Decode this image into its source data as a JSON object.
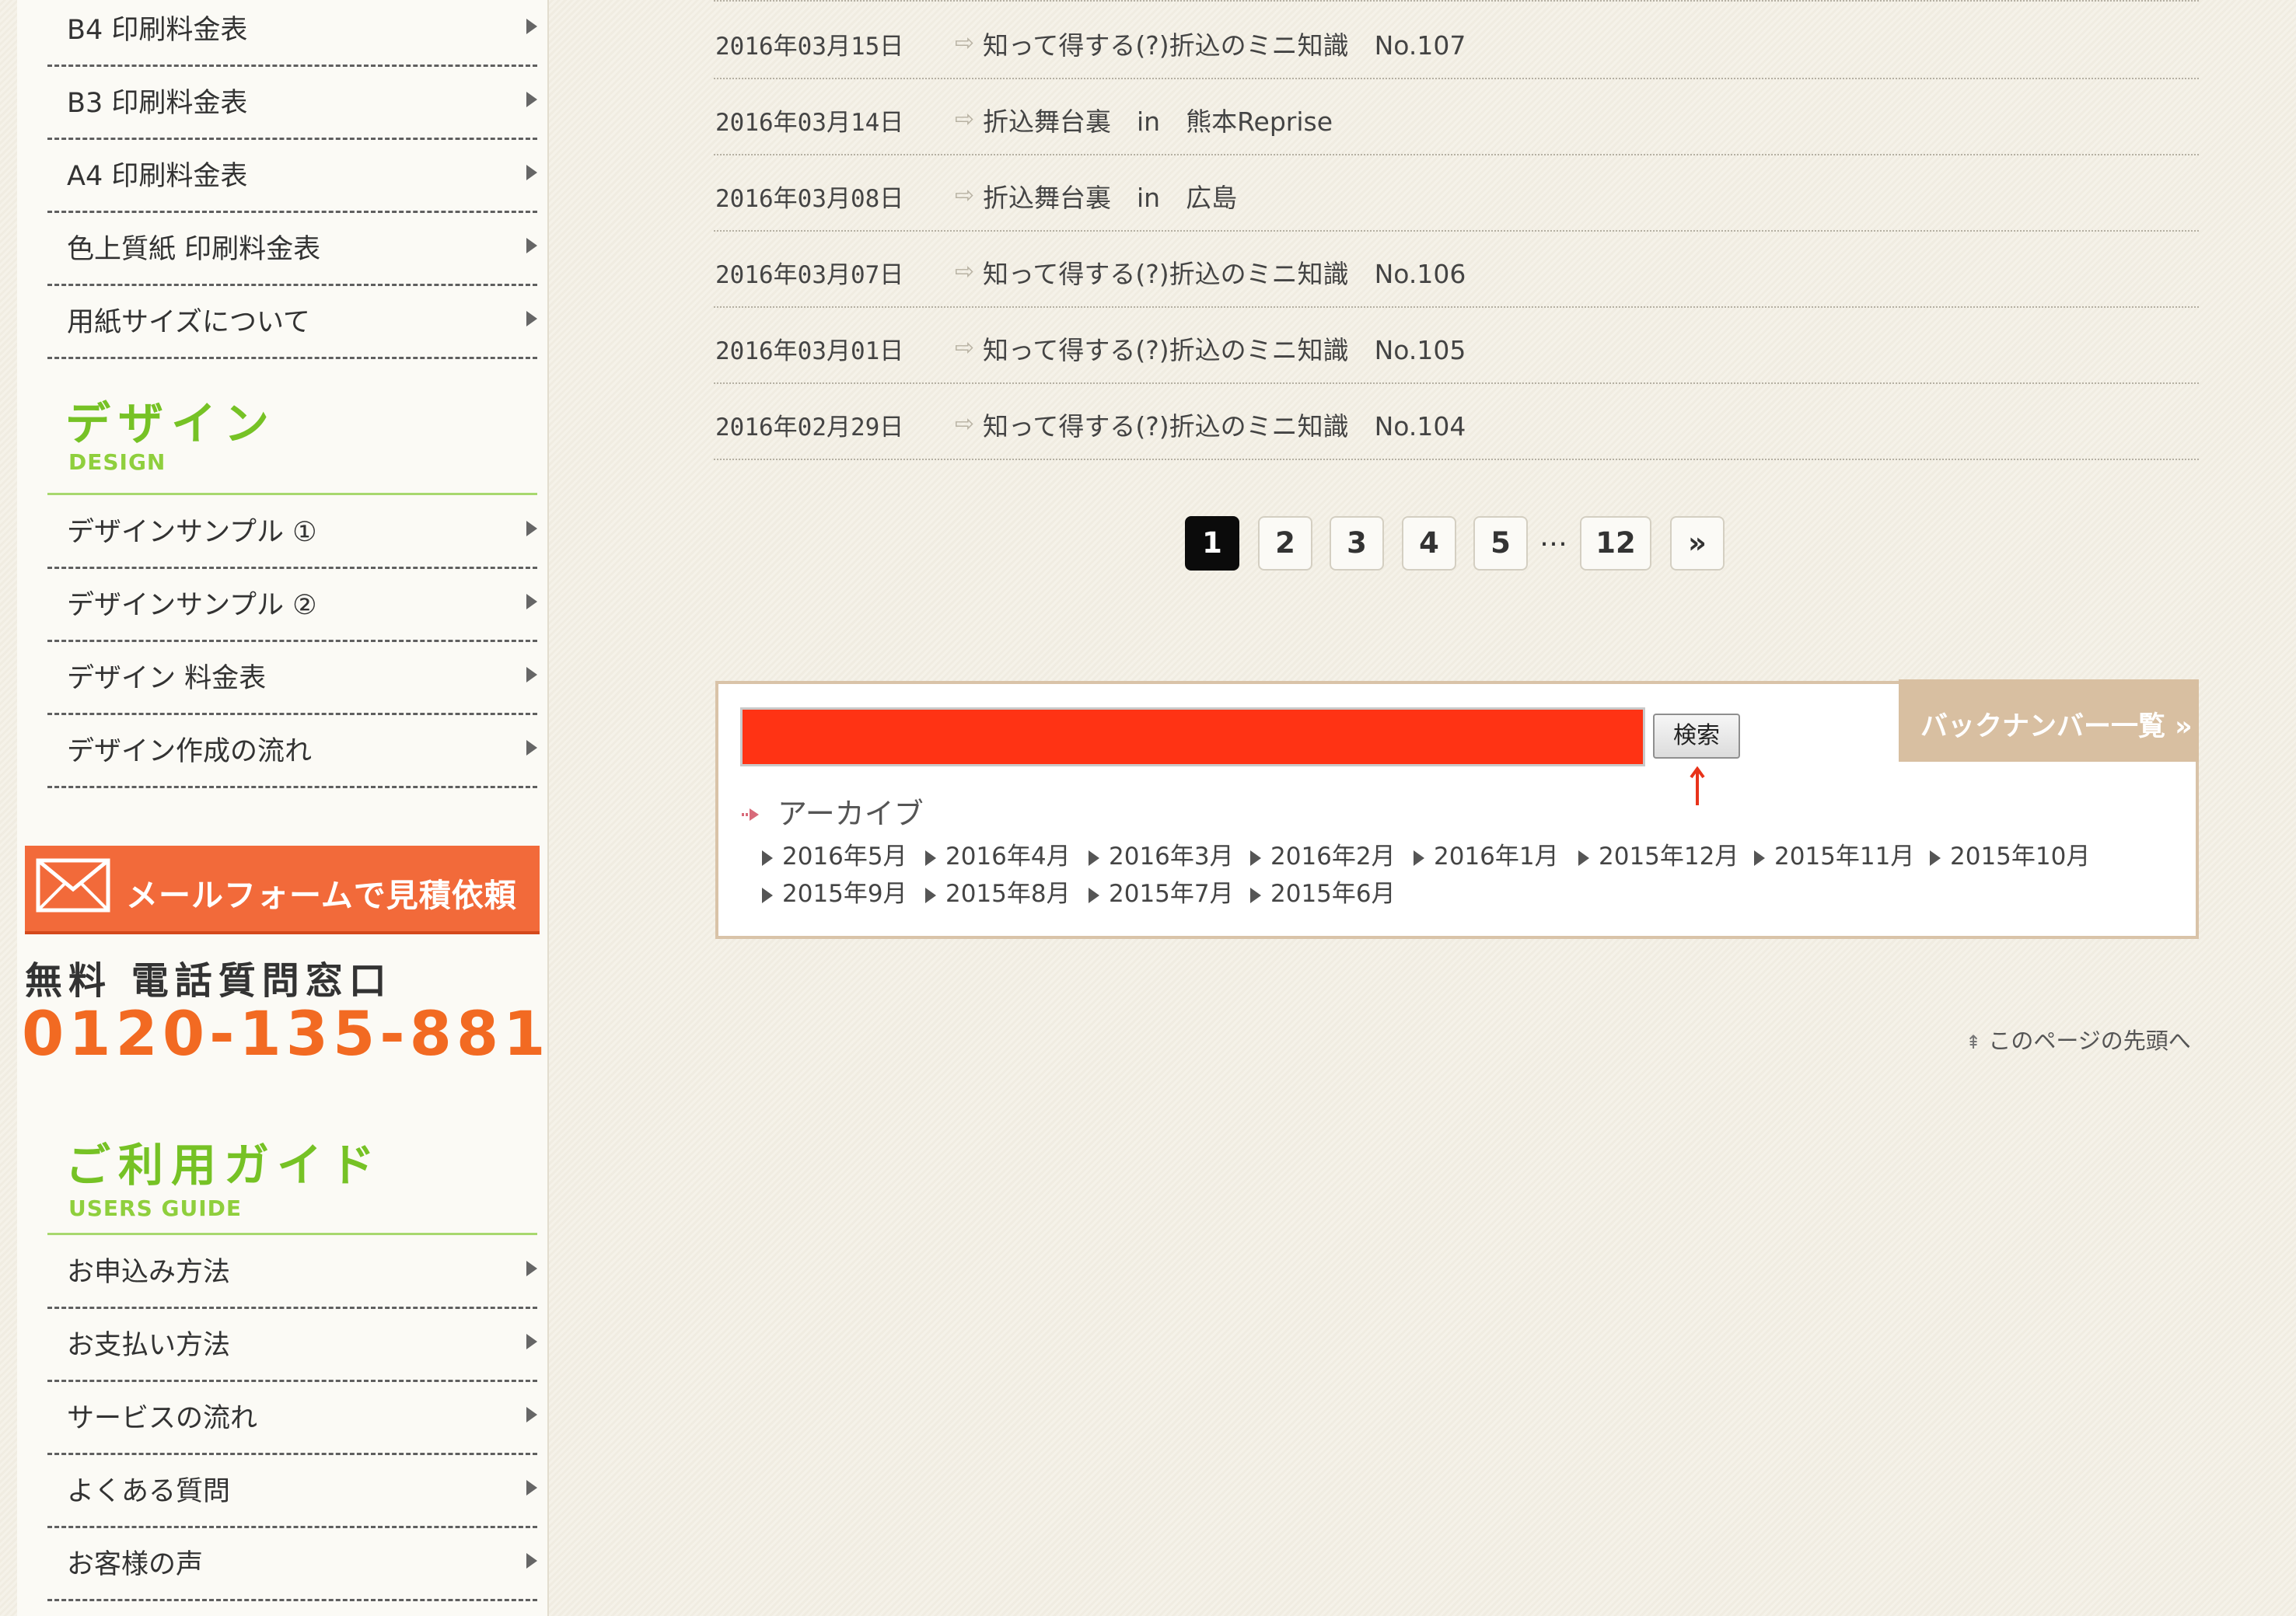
{
  "sidebar": {
    "print_items": [
      {
        "label": "B4 印刷料金表"
      },
      {
        "label": "B3 印刷料金表"
      },
      {
        "label": "A4 印刷料金表"
      },
      {
        "label": "色上質紙 印刷料金表"
      },
      {
        "label": "用紙サイズについて"
      }
    ],
    "design": {
      "title": "デザイン",
      "subtitle": "DESIGN",
      "items": [
        {
          "label": "デザインサンプル ①"
        },
        {
          "label": "デザインサンプル ②"
        },
        {
          "label": "デザイン 料金表"
        },
        {
          "label": "デザイン作成の流れ"
        }
      ]
    },
    "mail_banner": "メールフォームで見積依頼",
    "phone_label": "無料 電話質問窓口",
    "phone_number": "0120-135-881",
    "guide": {
      "title": "ご利用ガイド",
      "subtitle": "USERS GUIDE",
      "items": [
        {
          "label": "お申込み方法"
        },
        {
          "label": "お支払い方法"
        },
        {
          "label": "サービスの流れ"
        },
        {
          "label": "よくある質問"
        },
        {
          "label": "お客様の声"
        }
      ]
    }
  },
  "news": [
    {
      "date": "2016年03月15日",
      "title": "知って得する(?)折込のミニ知識　No.107"
    },
    {
      "date": "2016年03月14日",
      "title": "折込舞台裏　in　熊本Reprise"
    },
    {
      "date": "2016年03月08日",
      "title": "折込舞台裏　in　広島"
    },
    {
      "date": "2016年03月07日",
      "title": "知って得する(?)折込のミニ知識　No.106"
    },
    {
      "date": "2016年03月01日",
      "title": "知って得する(?)折込のミニ知識　No.105"
    },
    {
      "date": "2016年02月29日",
      "title": "知って得する(?)折込のミニ知識　No.104"
    }
  ],
  "pagination": {
    "pages": [
      "1",
      "2",
      "3",
      "4",
      "5"
    ],
    "ellipsis": "…",
    "last": "12",
    "next": "»"
  },
  "search": {
    "button_label": "検索",
    "backnumber_label": "バックナンバー一覧 »",
    "archive_heading": "アーカイブ",
    "archive_months": [
      "2016年5月",
      "2016年4月",
      "2016年3月",
      "2016年2月",
      "2016年1月",
      "2015年12月",
      "2015年11月",
      "2015年10月",
      "2015年9月",
      "2015年8月",
      "2015年7月",
      "2015年6月"
    ]
  },
  "page_top": "このページの先頭へ",
  "colors": {
    "accent_green": "#76c225",
    "accent_orange": "#f26a3a",
    "search_highlight": "#ff3314"
  }
}
